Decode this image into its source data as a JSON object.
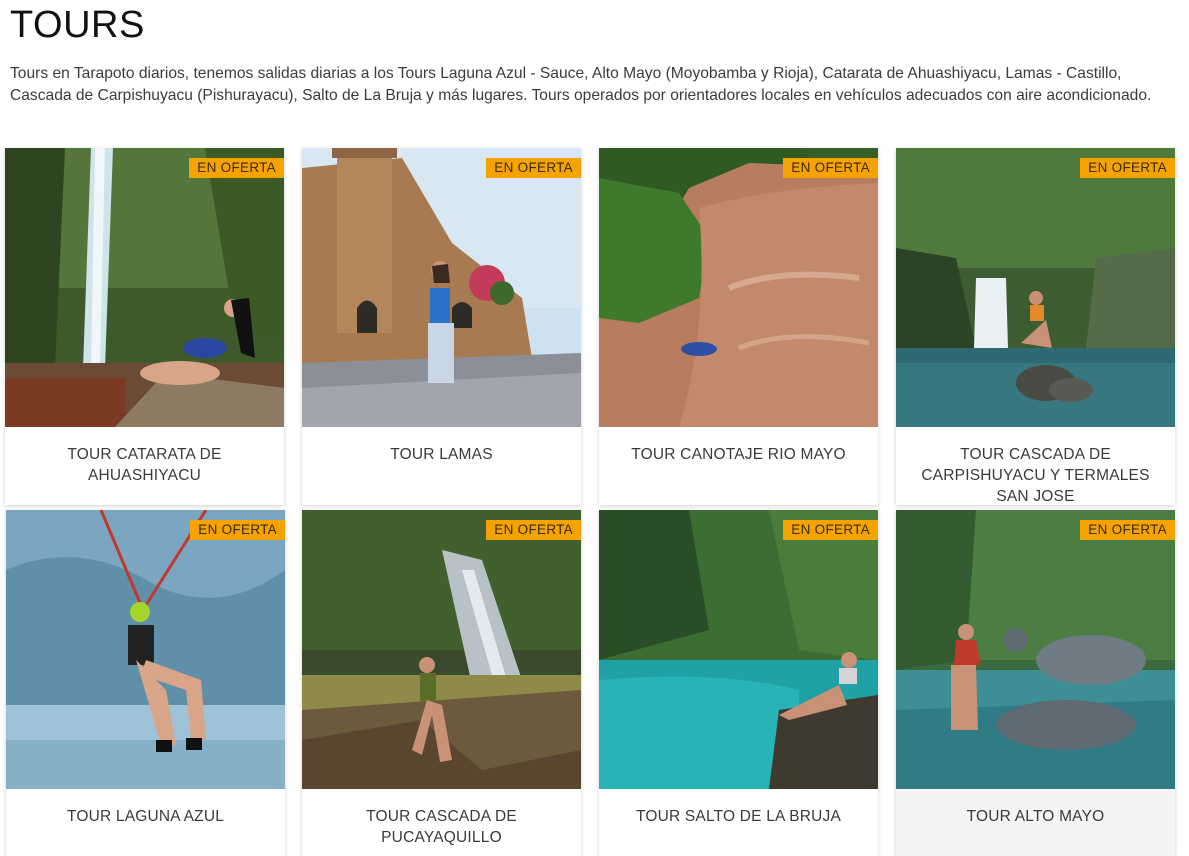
{
  "page": {
    "title": "TOURS",
    "intro": "Tours en Tarapoto diarios, tenemos salidas diarias a los Tours Laguna Azul - Sauce, Alto Mayo (Moyobamba y Rioja), Catarata de Ahuashiyacu, Lamas - Castillo, Cascada de Carpishuyacu (Pishurayacu), Salto de La Bruja y más lugares. Tours operados por orientadores locales en vehículos adecuados con aire acondicionado."
  },
  "tours": [
    {
      "title": "TOUR CATARATA DE AHUASHIYACU",
      "badge": "EN OFERTA",
      "image": "waterfall-woman-rock"
    },
    {
      "title": "TOUR LAMAS",
      "badge": "EN OFERTA",
      "image": "castle-woman"
    },
    {
      "title": "TOUR CANOTAJE RIO MAYO",
      "badge": "EN OFERTA",
      "image": "river-raft-aerial"
    },
    {
      "title": "TOUR CASCADA DE CARPISHUYACU Y TERMALES SAN JOSE",
      "badge": "EN OFERTA",
      "image": "cascade-pool-woman"
    },
    {
      "title": "TOUR LAGUNA AZUL",
      "badge": "EN OFERTA",
      "image": "zipline-lake"
    },
    {
      "title": "TOUR CASCADA DE PUCAYAQUILLO",
      "badge": "EN OFERTA",
      "image": "waterfall-rocks-woman"
    },
    {
      "title": "TOUR SALTO DE LA BRUJA",
      "badge": "EN OFERTA",
      "image": "turquoise-pool-woman"
    },
    {
      "title": "TOUR ALTO MAYO",
      "badge": "EN OFERTA",
      "image": "stone-turtle-pool"
    }
  ],
  "colors": {
    "badge": "#f5a300",
    "card_bg": "#ffffff",
    "title_text": "#3a3a3a"
  }
}
